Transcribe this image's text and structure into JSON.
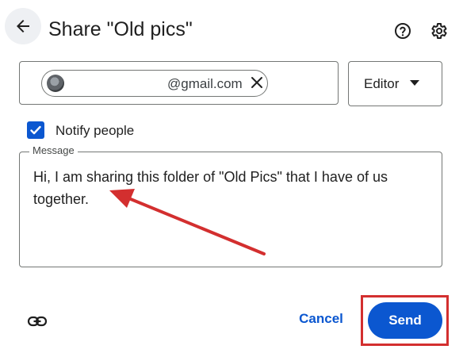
{
  "header": {
    "title": "Share \"Old pics\"",
    "back_icon": "arrow-back-icon",
    "help_icon": "help-circle-icon",
    "settings_icon": "gear-icon"
  },
  "recipient": {
    "chip_email": "@gmail.com",
    "remove_icon": "close-icon",
    "role": "Editor"
  },
  "notify": {
    "checked": true,
    "label": "Notify people"
  },
  "message": {
    "legend": "Message",
    "text": "Hi, I am sharing this folder of  \"Old Pics\" that I have of us together."
  },
  "footer": {
    "link_icon": "link-icon",
    "cancel_label": "Cancel",
    "send_label": "Send"
  },
  "colors": {
    "accent": "#0b57d0",
    "annotation": "#d32f2f"
  }
}
